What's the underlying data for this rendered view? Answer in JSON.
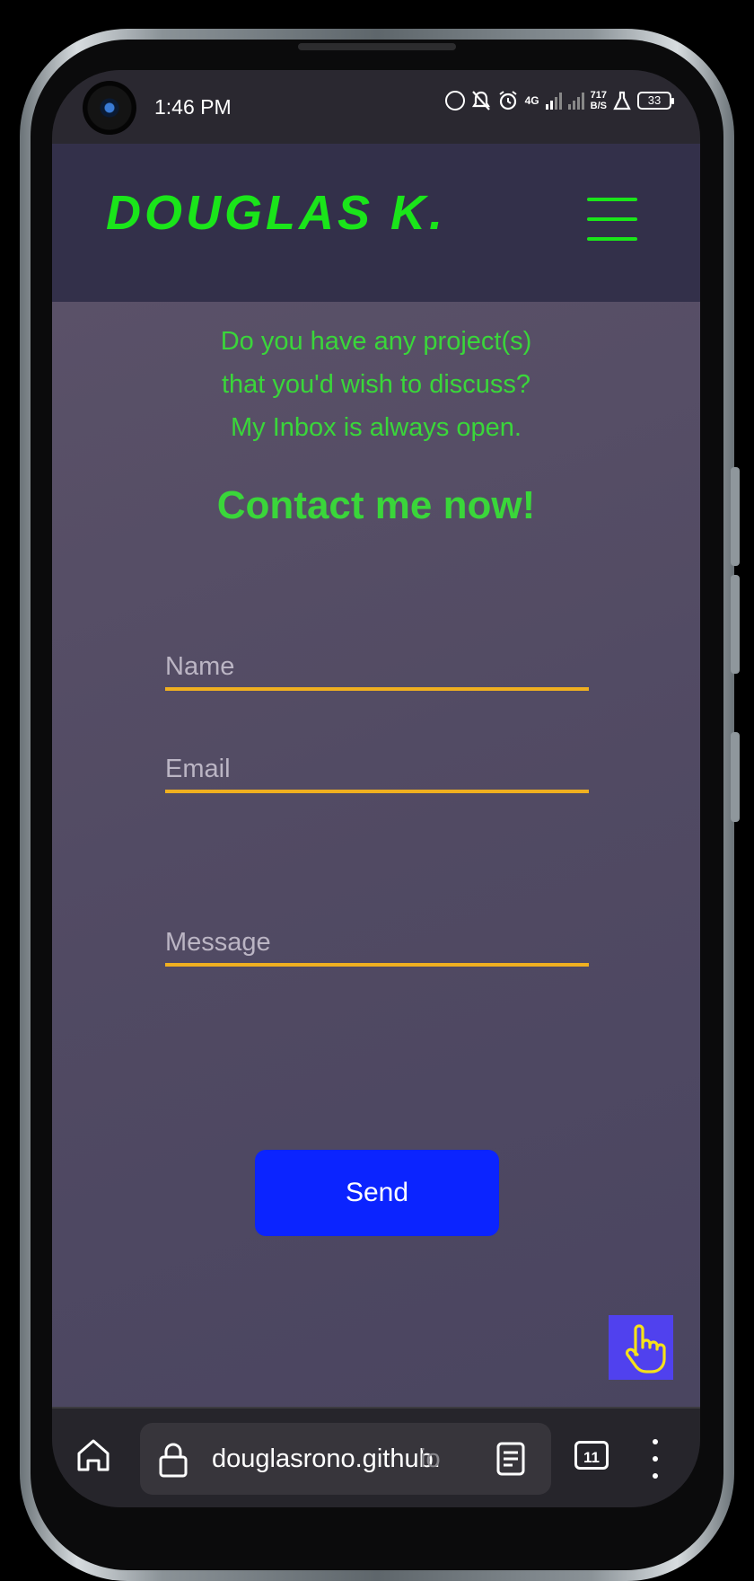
{
  "status_bar": {
    "time": "1:46 PM",
    "network_type": "4G",
    "data_rate_value": "717",
    "data_rate_unit": "B/S",
    "battery": "33"
  },
  "navbar": {
    "logo": "DOUGLAS K."
  },
  "intro": {
    "line1": "Do you have any project(s)",
    "line2": "that you'd wish to discuss?",
    "line3": "My Inbox is always open."
  },
  "heading": "Contact me now!",
  "form": {
    "name_placeholder": "Name",
    "email_placeholder": "Email",
    "message_placeholder": "Message",
    "send_label": "Send"
  },
  "browser": {
    "url_main": "douglasrono.github.",
    "url_faded": "io",
    "tab_count": "11"
  },
  "colors": {
    "accent_green": "#1ae51a",
    "underline_yellow": "#f0b020",
    "send_blue": "#0b24ff",
    "hand_button": "#5041ee"
  },
  "icons": [
    "home-icon",
    "lock-icon",
    "reader-mode-icon",
    "tab-switcher-icon",
    "more-options-icon",
    "hamburger-menu-icon",
    "pointing-hand-icon"
  ]
}
